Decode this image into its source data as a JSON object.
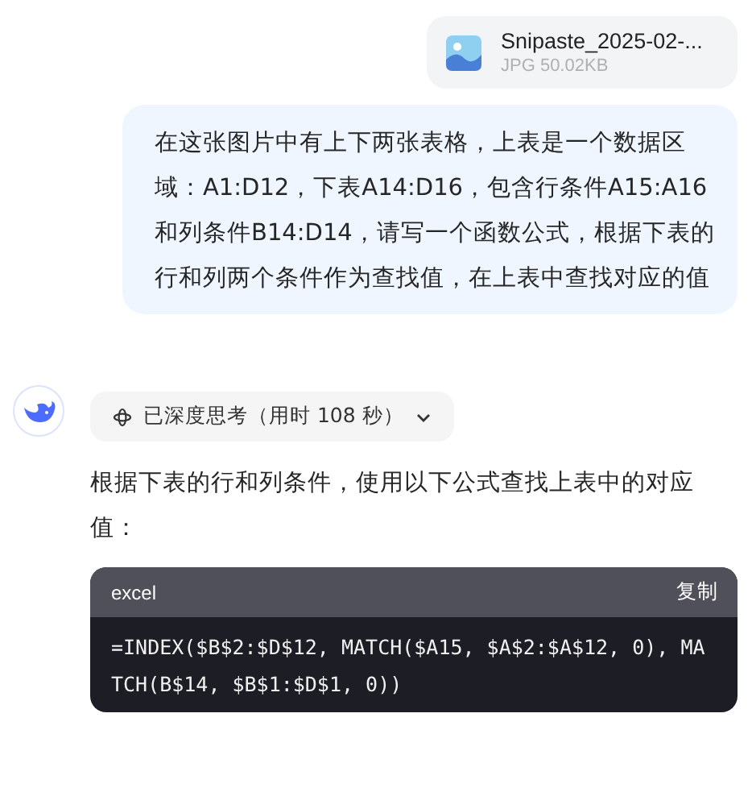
{
  "attachment": {
    "name": "Snipaste_2025-02-...",
    "meta": "JPG 50.02KB"
  },
  "user_message": "在这张图片中有上下两张表格，上表是一个数据区域：A1:D12，下表A14:D16，包含行条件A15:A16和列条件B14:D14，请写一个函数公式，根据下表的行和列两个条件作为查找值，在上表中查找对应的值",
  "thinking": {
    "label": "已深度思考（用时 108 秒）",
    "expanded": false
  },
  "answer": "根据下表的行和列条件，使用以下公式查找上表中的对应值：",
  "code_block": {
    "language": "excel",
    "copy_label": "复制",
    "lines": [
      "=INDEX($B$2:$D$12, MATCH($A15, $A$2:$A$12, 0), MA",
      "TCH(B$14, $B$1:$D$1, 0))"
    ]
  }
}
